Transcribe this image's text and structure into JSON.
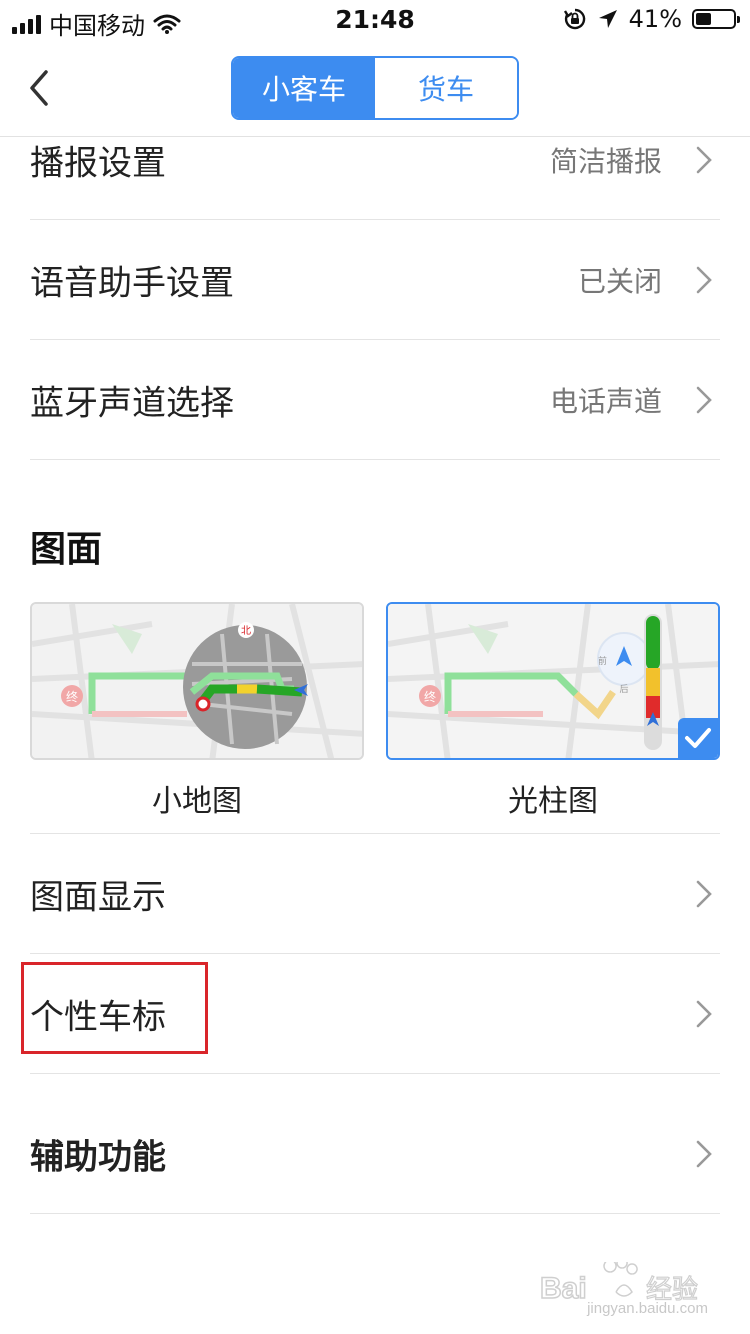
{
  "status_bar": {
    "carrier": "中国移动",
    "time": "21:48",
    "battery": "41%",
    "battery_level": 0.41
  },
  "nav": {
    "back_icon": "chevron-left-icon",
    "tabs": [
      {
        "label": "小客车",
        "active": true
      },
      {
        "label": "货车",
        "active": false
      }
    ],
    "accent_color": "#3d8cf0"
  },
  "settings": [
    {
      "label": "播报设置",
      "value": "简洁播报"
    },
    {
      "label": "语音助手设置",
      "value": "已关闭"
    },
    {
      "label": "蓝牙声道选择",
      "value": "电话声道"
    }
  ],
  "display_section": {
    "title": "图面",
    "modes": [
      {
        "label": "小地图",
        "selected": false
      },
      {
        "label": "光柱图",
        "selected": true
      }
    ],
    "map_labels": {
      "north": "北",
      "poi": "终",
      "side_a": "前",
      "side_b": "后"
    }
  },
  "display_rows": [
    {
      "label": "图面显示"
    },
    {
      "label": "个性车标",
      "highlighted": true
    },
    {
      "label": "辅助功能"
    }
  ],
  "watermark": {
    "brand": "Bai",
    "suffix": "经验",
    "sub": "jingyan.baidu.com"
  }
}
